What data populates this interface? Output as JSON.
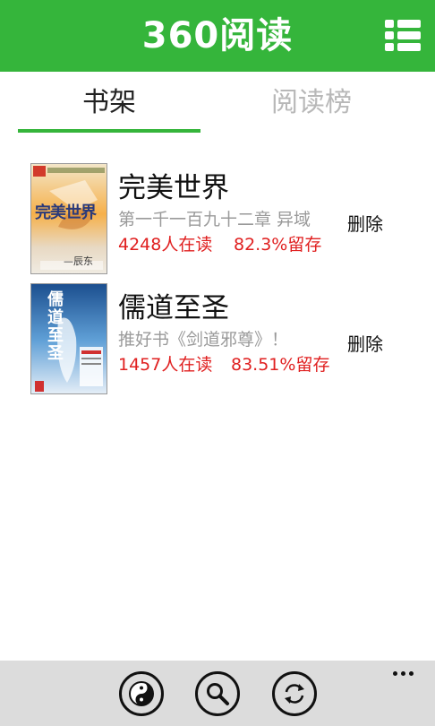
{
  "header": {
    "title": "360阅读",
    "background_color": "#35b53b",
    "menu_icon": "list-menu-icon"
  },
  "tabs": [
    {
      "label": "书架",
      "active": true
    },
    {
      "label": "阅读榜",
      "active": false
    }
  ],
  "books": [
    {
      "title": "完美世界",
      "latest": "第一千一百九十二章 异域",
      "readers": "4248人在读",
      "retention": "82.3%留存",
      "delete_label": "删除",
      "cover_text": "完美世界",
      "cover_author": "—辰东"
    },
    {
      "title": "儒道至圣",
      "latest": "推好书《剑道邪尊》！",
      "readers": "1457人在读",
      "retention": "83.51%留存",
      "delete_label": "删除",
      "cover_text": "儒道至圣"
    }
  ],
  "appbar": {
    "buttons": [
      "yin-yang-icon",
      "search-icon",
      "refresh-icon"
    ],
    "more_icon": "more-dots-icon"
  },
  "colors": {
    "accent": "#35b53b",
    "stat_red": "#e02020",
    "muted_gray": "#9a9a9a",
    "appbar_bg": "#dcdcdc"
  }
}
